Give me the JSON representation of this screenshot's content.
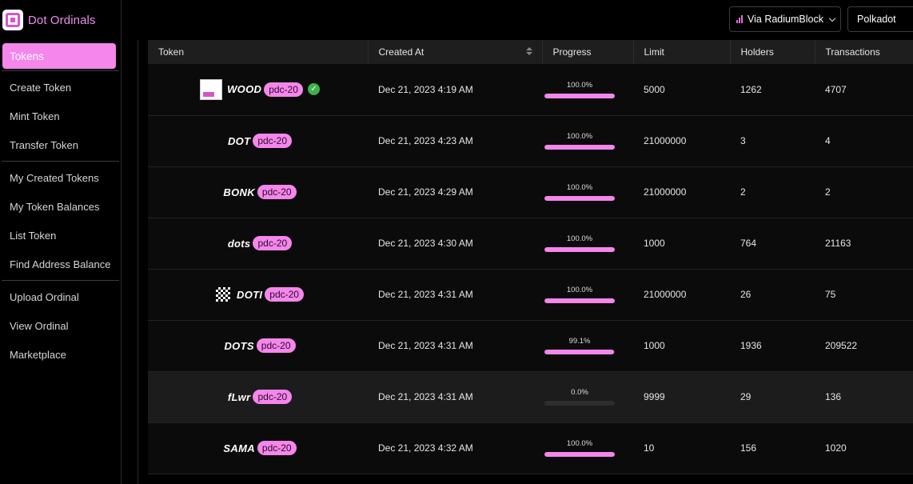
{
  "app": {
    "title": "Dot Ordinals",
    "logo_icon": "dot-ordinals-logo-icon"
  },
  "sidebar": {
    "active": "Tokens",
    "group1": [
      "Create Token",
      "Mint Token",
      "Transfer Token"
    ],
    "group2": [
      "My Created Tokens",
      "My Token Balances",
      "List Token",
      "Find Address Balance"
    ],
    "group3": [
      "Upload Ordinal",
      "View Ordinal",
      "Marketplace"
    ]
  },
  "header": {
    "rpc_label": "Via RadiumBlock",
    "network_label": "Polkadot"
  },
  "colors": {
    "accent": "#f586ec",
    "verified": "#3cb34a"
  },
  "table": {
    "columns": [
      "Token",
      "Created At",
      "Progress",
      "Limit",
      "Holders",
      "Transactions"
    ],
    "rows": [
      {
        "name": "WOOD",
        "badge": "pdc-20",
        "icon": "wood-token-image",
        "verified": true,
        "created": "Dec 21, 2023 4:19 AM",
        "progress_label": "100.0%",
        "progress": 1.0,
        "limit": "5000",
        "holders": "1262",
        "transactions": "4707"
      },
      {
        "name": "DOT",
        "badge": "pdc-20",
        "icon": "",
        "verified": false,
        "created": "Dec 21, 2023 4:23 AM",
        "progress_label": "100.0%",
        "progress": 1.0,
        "limit": "21000000",
        "holders": "3",
        "transactions": "4"
      },
      {
        "name": "BONK",
        "badge": "pdc-20",
        "icon": "",
        "verified": false,
        "created": "Dec 21, 2023 4:29 AM",
        "progress_label": "100.0%",
        "progress": 1.0,
        "limit": "21000000",
        "holders": "2",
        "transactions": "2"
      },
      {
        "name": "dots",
        "badge": "pdc-20",
        "icon": "",
        "verified": false,
        "created": "Dec 21, 2023 4:30 AM",
        "progress_label": "100.0%",
        "progress": 1.0,
        "limit": "1000",
        "holders": "764",
        "transactions": "21163"
      },
      {
        "name": "DOTI",
        "badge": "pdc-20",
        "icon": "doti-token-image",
        "verified": false,
        "created": "Dec 21, 2023 4:31 AM",
        "progress_label": "100.0%",
        "progress": 1.0,
        "limit": "21000000",
        "holders": "26",
        "transactions": "75"
      },
      {
        "name": "DOTS",
        "badge": "pdc-20",
        "icon": "",
        "verified": false,
        "created": "Dec 21, 2023 4:31 AM",
        "progress_label": "99.1%",
        "progress": 0.991,
        "limit": "1000",
        "holders": "1936",
        "transactions": "209522"
      },
      {
        "name": "fLwr",
        "badge": "pdc-20",
        "icon": "",
        "verified": false,
        "created": "Dec 21, 2023 4:31 AM",
        "progress_label": "0.0%",
        "progress": 0.0,
        "limit": "9999",
        "holders": "29",
        "transactions": "136",
        "highlighted": true
      },
      {
        "name": "SAMA",
        "badge": "pdc-20",
        "icon": "",
        "verified": false,
        "created": "Dec 21, 2023 4:32 AM",
        "progress_label": "100.0%",
        "progress": 1.0,
        "limit": "10",
        "holders": "156",
        "transactions": "1020"
      }
    ]
  }
}
